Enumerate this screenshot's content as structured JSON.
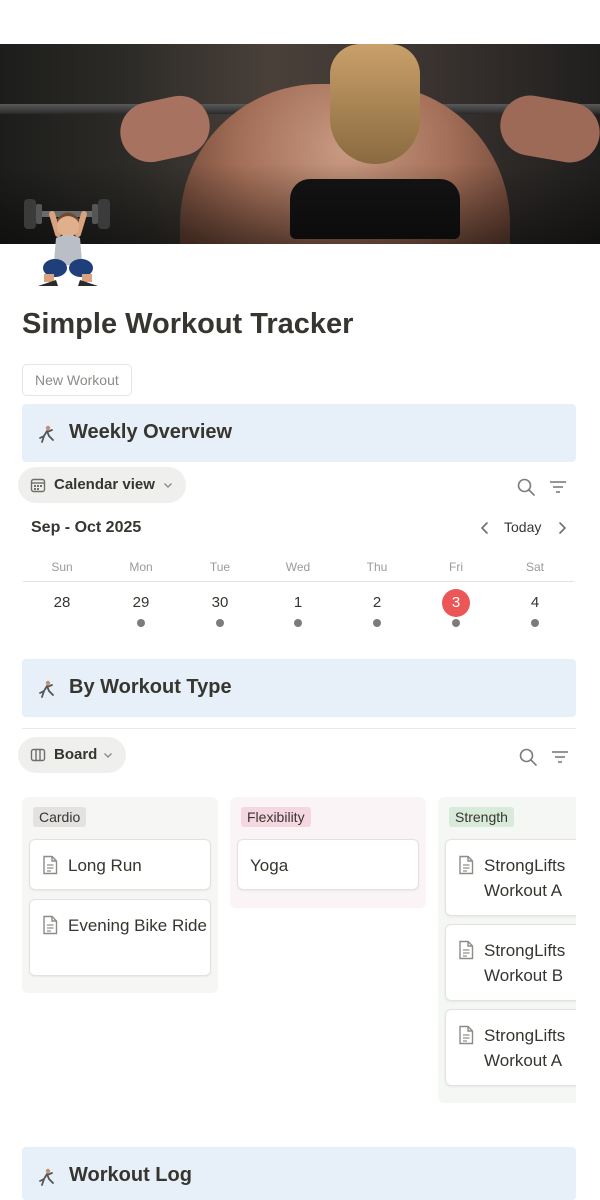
{
  "page": {
    "title": "Simple Workout Tracker",
    "new_button": "New Workout"
  },
  "sections": {
    "weekly": "Weekly Overview",
    "by_type": "By Workout Type",
    "log": "Workout Log"
  },
  "calendar": {
    "view_label": "Calendar view",
    "month_label": "Sep - Oct 2025",
    "today_label": "Today",
    "weekdays": [
      "Sun",
      "Mon",
      "Tue",
      "Wed",
      "Thu",
      "Fri",
      "Sat"
    ],
    "days": [
      "28",
      "29",
      "30",
      "1",
      "2",
      "3",
      "4"
    ],
    "today_index": 5,
    "has_entries": [
      false,
      true,
      true,
      true,
      true,
      true,
      true
    ],
    "today_color": "#eb5757"
  },
  "board": {
    "view_label": "Board",
    "columns": [
      {
        "tag": "Cardio",
        "tag_color": "#e3e2e0",
        "cards": [
          "Long Run",
          "Evening Bike Ride"
        ]
      },
      {
        "tag": "Flexibility",
        "tag_color": "#f5d7e2",
        "cards": [
          "Yoga"
        ]
      },
      {
        "tag": "Strength",
        "tag_color": "#d8ead9",
        "cards": [
          "StrongLifts Workout A",
          "StrongLifts Workout B",
          "StrongLifts Workout A"
        ]
      }
    ]
  },
  "colors": {
    "callout_bg": "#e7f0f9",
    "text": "#37352f",
    "muted": "#9b9a97"
  },
  "icons": {
    "page": "weightlifter-icon",
    "section": "athlete-icon",
    "calendar": "calendar-icon",
    "board": "board-icon",
    "search": "search-icon",
    "filter": "filter-icon",
    "document": "document-icon"
  }
}
